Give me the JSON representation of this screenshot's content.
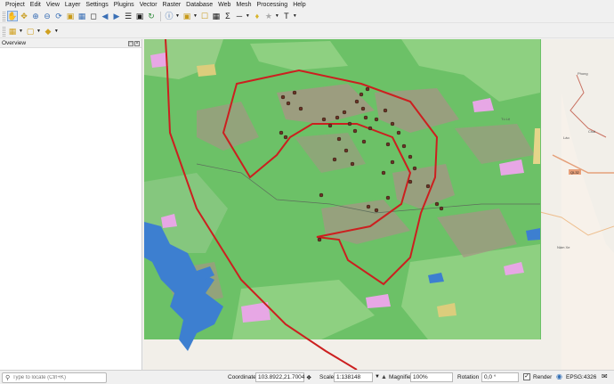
{
  "menubar": {
    "items": [
      "Project",
      "Edit",
      "View",
      "Layer",
      "Settings",
      "Plugins",
      "Vector",
      "Raster",
      "Database",
      "Web",
      "Mesh",
      "Processing",
      "Help"
    ]
  },
  "toolbar": {
    "icons": [
      "pan-icon",
      "pan-to-selection-icon",
      "zoom-in-icon",
      "zoom-out-icon",
      "zoom-full-icon",
      "zoom-selection-icon",
      "zoom-layer-icon",
      "zoom-native-icon",
      "zoom-last-icon",
      "zoom-next-icon",
      "new-bookmark-icon",
      "show-bookmarks-icon",
      "refresh-icon",
      "identify-icon",
      "select-icon",
      "deselect-icon",
      "attribute-table-icon",
      "statistics-icon",
      "measure-icon",
      "annotation-icon",
      "text-icon"
    ],
    "layer_icons": [
      "open-layer-icon",
      "add-vector-icon",
      "add-raster-icon"
    ]
  },
  "panel": {
    "title": "Overview"
  },
  "status": {
    "locator_placeholder": "Type to locate (Ctrl+K)",
    "coordinate_label": "Coordinate",
    "coordinate_value": "103.8922,21.7004",
    "scale_label": "Scale",
    "scale_value": "1:138148",
    "magnifier_label": "Magnifier",
    "magnifier_value": "100%",
    "rotation_label": "Rotation",
    "rotation_value": "0,0 °",
    "render_label": "Render",
    "render_checked": true,
    "crs_label": "EPSG:4326"
  },
  "map": {
    "labels": [
      "Phong",
      "Lào",
      "Chài",
      "QL32",
      "Tú Lệ",
      "Nậm Xe"
    ],
    "colors": {
      "forest": "#6cc167",
      "farmland": "#8fc98a",
      "bare": "#a09282",
      "water": "#3d7fd0",
      "road": "#cc1f1f",
      "points": "#6b3425"
    }
  }
}
